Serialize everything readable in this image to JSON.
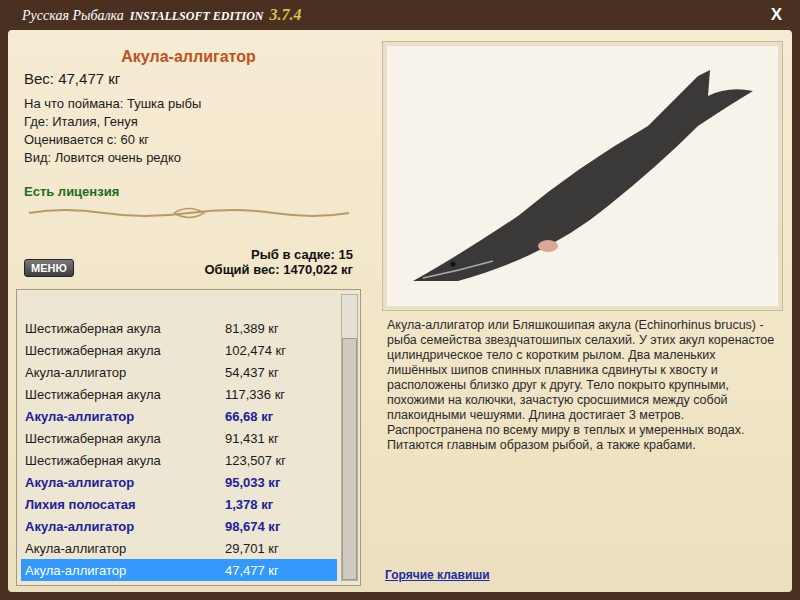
{
  "app": {
    "title": "Русская Рыбалка",
    "edition": "INSTALLSOFT EDITION",
    "version": "3.7.4",
    "close": "X"
  },
  "fish": {
    "name": "Акула-аллигатор",
    "weight": "Вес: 47,477 кг",
    "details": [
      "На что поймана: Тушка рыбы",
      "Где: Италия, Генуя",
      "Оценивается с: 60 кг",
      "Вид: Ловится очень редко"
    ],
    "license": "Есть лицензия"
  },
  "menu_button": "МЕНЮ",
  "keepnet": {
    "count": "Рыб в садке: 15",
    "total": "Общий вес: 1470,022 кг"
  },
  "catch_list": [
    {
      "name": "Шестижаберная акула",
      "weight": "81,389 кг",
      "trophy": false,
      "selected": false
    },
    {
      "name": "Шестижаберная акула",
      "weight": "102,474 кг",
      "trophy": false,
      "selected": false
    },
    {
      "name": "Акула-аллигатор",
      "weight": "54,437 кг",
      "trophy": false,
      "selected": false
    },
    {
      "name": "Шестижаберная акула",
      "weight": "117,336 кг",
      "trophy": false,
      "selected": false
    },
    {
      "name": "Акула-аллигатор",
      "weight": "66,68 кг",
      "trophy": true,
      "selected": false
    },
    {
      "name": "Шестижаберная акула",
      "weight": "91,431 кг",
      "trophy": false,
      "selected": false
    },
    {
      "name": "Шестижаберная акула",
      "weight": "123,507 кг",
      "trophy": false,
      "selected": false
    },
    {
      "name": "Акула-аллигатор",
      "weight": "95,033 кг",
      "trophy": true,
      "selected": false
    },
    {
      "name": "Лихия полосатая",
      "weight": "1,378 кг",
      "trophy": true,
      "selected": false
    },
    {
      "name": "Акула-аллигатор",
      "weight": "98,674 кг",
      "trophy": true,
      "selected": false
    },
    {
      "name": "Акула-аллигатор",
      "weight": "29,701 кг",
      "trophy": false,
      "selected": false
    },
    {
      "name": "Акула-аллигатор",
      "weight": "47,477 кг",
      "trophy": false,
      "selected": true
    }
  ],
  "scrollbar": {
    "level": 0.85
  },
  "description": "Акула-аллигатор или Бляшкошипая акула (Echinorhinus brucus) - рыба семейства звездчатошипых селахий. У этих акул коренастое цилиндрическое тело с коротким рылом. Два маленьких лишённых шипов спинных плавника сдвинуты к хвосту и расположены близко друг к другу. Тело покрыто крупными, похожими на колючки, зачастую сросшимися между собой плакоидными чешуями. Длина достигает 3 метров. Распространена по всему миру в теплых и умеренных водах. Питаются главным образом рыбой, а также крабами.",
  "hotkeys_link": "Горячие клавиши"
}
